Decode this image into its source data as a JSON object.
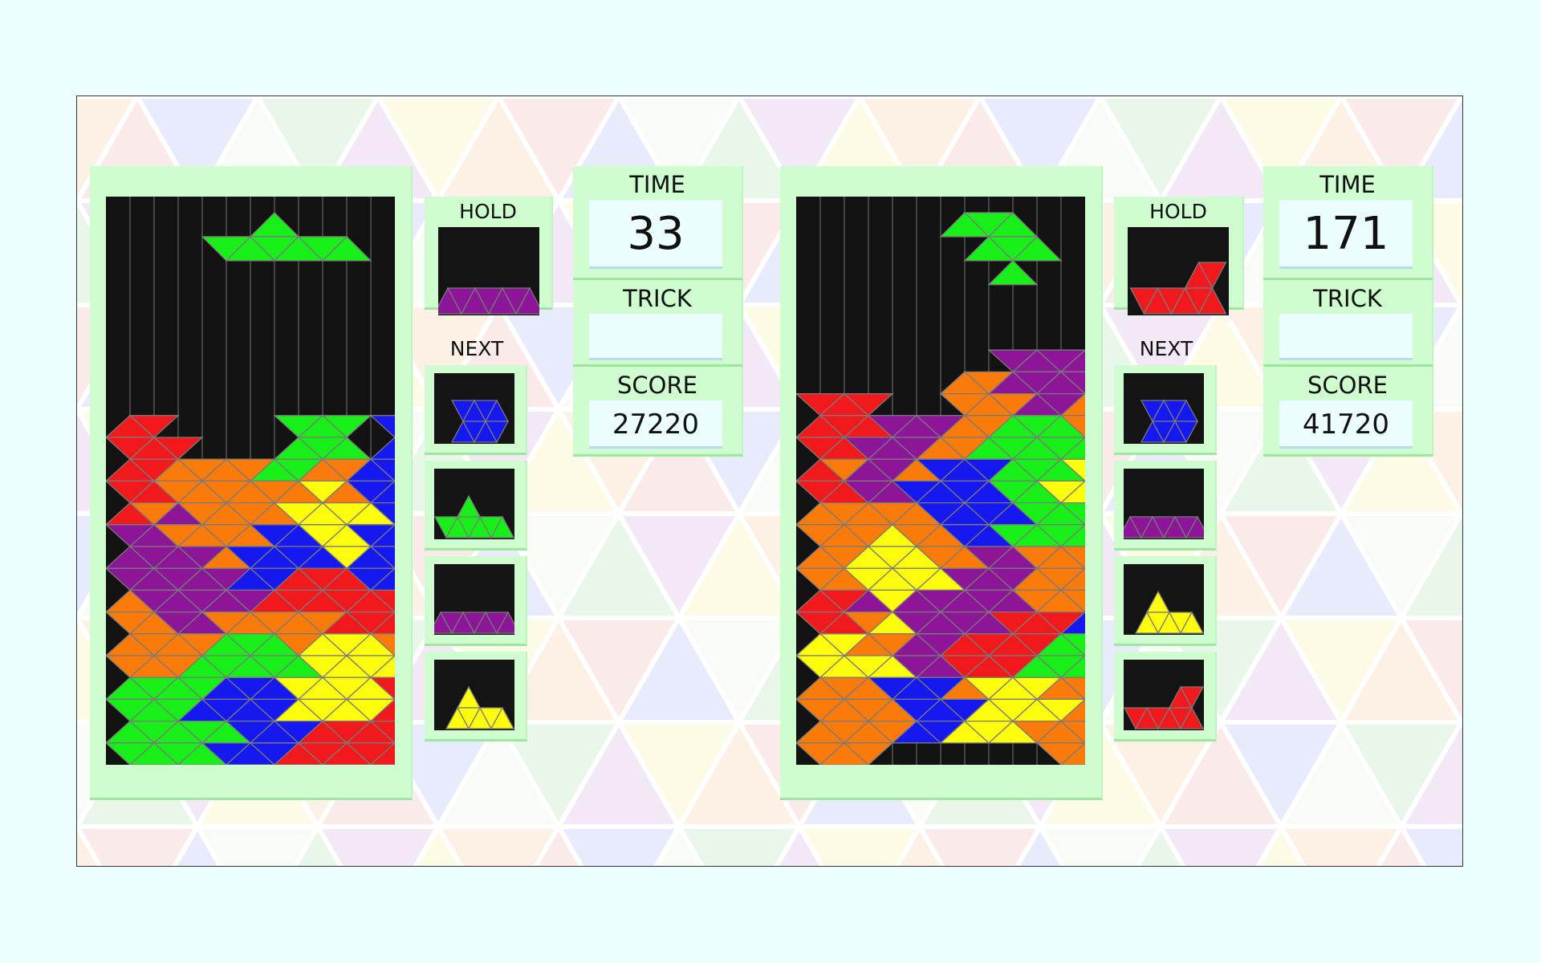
{
  "colors": {
    "red": "#f2191d",
    "orange": "#fa7b0a",
    "yellow": "#fdfd0b",
    "green": "#18ef18",
    "blue": "#1519f0",
    "purple": "#8c1598",
    "ghost": "#0f3b10",
    "well": "#131313",
    "panel": "#cffdd0",
    "page": "#ecfefd"
  },
  "players": [
    {
      "hold_label": "HOLD",
      "next_label": "NEXT",
      "time_label": "TIME",
      "time_value": "33",
      "trick_label": "TRICK",
      "trick_value": "",
      "score_label": "SCORE",
      "score_value": "27220",
      "hold_piece": "purple-bar",
      "next_pieces": [
        "blue-double-diamond",
        "green-pyramid",
        "purple-bar",
        "yellow-pyramid"
      ],
      "active_piece": "green-pyramid",
      "board": [
        [],
        [],
        [],
        [],
        [],
        [],
        [],
        [],
        [],
        [],
        [],
        [],
        [],
        [],
        [],
        [],
        "RR.....GGG.BBB..........",
        "RRR....GGG.BBBB.........",
        "RROOOOGGOOBBBBBB........",
        "RROOOOOOYOBBBBBB.YYYYYY.",
        "ROPOOOOYYYYBBBBRRYYYYYY.",
        "PPOOOOBBYYBBBBRRPYYYYYYY",
        "PPPPOBBBBYBBBRRGGYYYYYYY",
        "PPPPPBBRRRBBBRRGGYYPPPPP",
        "OPPPPPRRRRRRGGGGGYPPPPRR",
        "OOPPOOOOORRRGGGGPPPPPRRR",
        "OOOOGGGOYYYOOOGGPPPRRRRR",
        "OOOGGGGGYYYYOOOGPPPPPPRR",
        "GGGGBBBYYYYRRPPPPPYYYYRR",
        "GGGBBBBYYYYRRPPPPPYYYYRR",
        "GGGGGBBBRRRRRRRPPYYYYYYR",
        "GGGGBBBRRRRRRRPPPYYYYYYY"
      ]
    },
    {
      "hold_label": "HOLD",
      "next_label": "NEXT",
      "time_label": "TIME",
      "time_value": "171",
      "trick_label": "TRICK",
      "trick_value": "",
      "score_label": "SCORE",
      "score_value": "41720",
      "hold_piece": "red-stair",
      "next_pieces": [
        "blue-double-diamond",
        "purple-bar",
        "yellow-pyramid",
        "red-stair"
      ],
      "active_piece": "green-diamond",
      "board": [
        [],
        [],
        [],
        [],
        [],
        [],
        [],
        [],
        [],
        [],
        [],
        [],
        [],
        [],
        [],
        [],
        "..................GGG...",
        "........PPPP.....GGGG...",
        "......OOPPPPOBBBBGGGGGGG",
        "RRR...OOOPPOOOBBBBYGGGGG",
        "RRRPPPOOGGGOOOBBBYYYYYYY",
        "RRPPPOOGGGGGGBBBBBYYYYYY",
        "ROPPOBBBGGGYYYYBBYYYYYYY",
        "RRPPBBBBGGYYYYYYYYYYYYYY",
        "OOOOOBBBBGGGGGPPPPPPPPPR",
        "OOOYOOBBGGGGGGPPPPPPPPRR",
        "OOYYYOOPPOOORRRRRRRRRRRR",
        "OOYYYYPPPOOORRRRRRRRRRRR",
        "RRPYPPPPPOOOOBBBBBBGGGGG",
        "RROYPPPPRRRBBBBBBBGGGGGG",
        "YYOOPPRRRRGGGGBBBBBGGGGG",
        "YYYYPPRRRGGGGGGBBBBGGGGG",
        "OOOBBBOYYYOOOPPPBBBRRRR.",
        "OOOOBBBYYYYOOPPPBBBORRRR",
        "OOOOBBYYYOOOPPPPPPOORRRR",
        "OOO.......OO..PP.....RRR"
      ]
    }
  ]
}
